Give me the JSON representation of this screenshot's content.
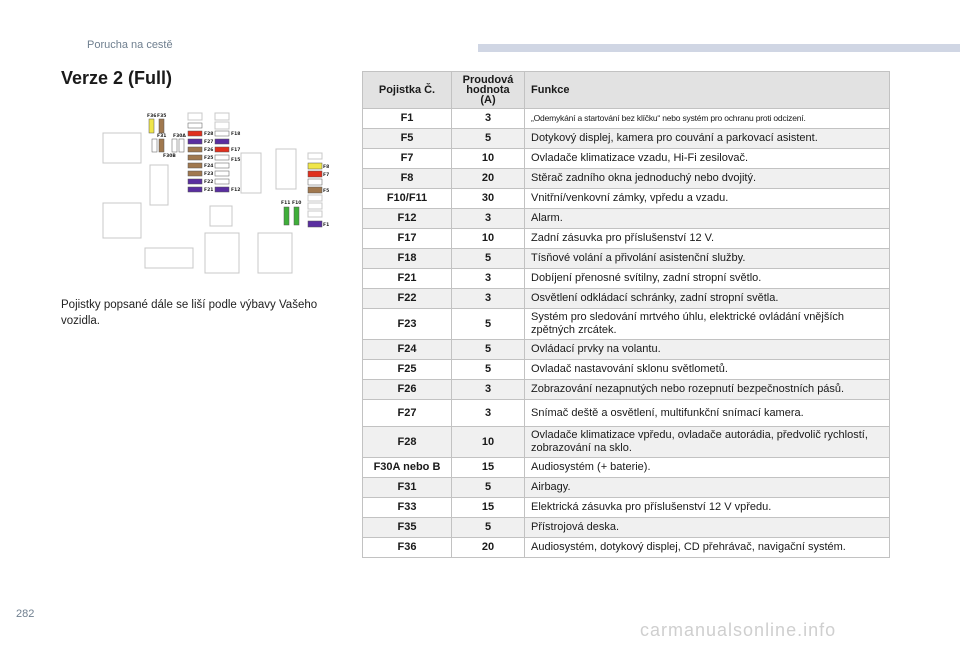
{
  "header": {
    "section": "Porucha na cestě"
  },
  "title": "Verze 2 (Full)",
  "note": "Pojistky popsané dále se liší podle výbavy Vašeho vozidla.",
  "page_number": "282",
  "watermark": "carmanualsonline.info",
  "colors": {
    "header_bar": "#d0d6e4",
    "table_header": "#e2e2e2",
    "fuse_brown": "#a0784e",
    "fuse_violet": "#5a2ea0",
    "fuse_yellow": "#f0e64a",
    "fuse_red": "#e0301e",
    "fuse_green": "#3fae3a"
  },
  "diagram": {
    "labels": [
      "F36",
      "F35",
      "F31",
      "F30A",
      "F30B",
      "F28",
      "F27",
      "F26",
      "F25",
      "F24",
      "F23",
      "F22",
      "F21",
      "F18",
      "F17",
      "F15",
      "F12",
      "F8",
      "F7",
      "F5",
      "F1",
      "F11",
      "F10"
    ]
  },
  "table": {
    "headers": {
      "fuse": "Pojistka Č.",
      "amp": "Proudová hodnota (A)",
      "func": "Funkce"
    },
    "rows": [
      {
        "fuse": "F1",
        "amp": "3",
        "func": "„Odemykání a startování bez klíčku“ nebo systém pro ochranu proti odcizení."
      },
      {
        "fuse": "F5",
        "amp": "5",
        "func": "Dotykový displej, kamera pro couvání a parkovací asistent."
      },
      {
        "fuse": "F7",
        "amp": "10",
        "func": "Ovladače klimatizace vzadu, Hi-Fi zesilovač."
      },
      {
        "fuse": "F8",
        "amp": "20",
        "func": "Stěrač zadního okna jednoduchý nebo dvojitý."
      },
      {
        "fuse": "F10/F11",
        "amp": "30",
        "func": "Vnitřní/venkovní zámky, vpředu a vzadu."
      },
      {
        "fuse": "F12",
        "amp": "3",
        "func": "Alarm."
      },
      {
        "fuse": "F17",
        "amp": "10",
        "func": "Zadní zásuvka pro příslušenství 12 V."
      },
      {
        "fuse": "F18",
        "amp": "5",
        "func": "Tísňové volání a přivolání asistenční služby."
      },
      {
        "fuse": "F21",
        "amp": "3",
        "func": "Dobíjení přenosné svítilny, zadní stropní světlo."
      },
      {
        "fuse": "F22",
        "amp": "3",
        "func": "Osvětlení odkládací schránky, zadní stropní světla."
      },
      {
        "fuse": "F23",
        "amp": "5",
        "func": "Systém pro sledování mrtvého úhlu, elektrické ovládání vnějších zpětných zrcátek."
      },
      {
        "fuse": "F24",
        "amp": "5",
        "func": "Ovládací prvky na volantu."
      },
      {
        "fuse": "F25",
        "amp": "5",
        "func": "Ovladač nastavování sklonu světlometů."
      },
      {
        "fuse": "F26",
        "amp": "3",
        "func": "Zobrazování nezapnutých nebo rozepnutí bezpečnostních pásů."
      },
      {
        "fuse": "F27",
        "amp": "3",
        "func": "Snímač deště a osvětlení, multifunkční snímací kamera."
      },
      {
        "fuse": "F28",
        "amp": "10",
        "func": "Ovladače klimatizace vpředu, ovladače autorádia, předvolič rychlostí, zobrazování na sklo."
      },
      {
        "fuse": "F30A nebo B",
        "amp": "15",
        "func": "Audiosystém (+ baterie)."
      },
      {
        "fuse": "F31",
        "amp": "5",
        "func": "Airbagy."
      },
      {
        "fuse": "F33",
        "amp": "15",
        "func": "Elektrická zásuvka pro příslušenství 12 V vpředu."
      },
      {
        "fuse": "F35",
        "amp": "5",
        "func": "Přístrojová deska."
      },
      {
        "fuse": "F36",
        "amp": "20",
        "func": "Audiosystém, dotykový displej, CD přehrávač, navigační systém."
      }
    ]
  }
}
